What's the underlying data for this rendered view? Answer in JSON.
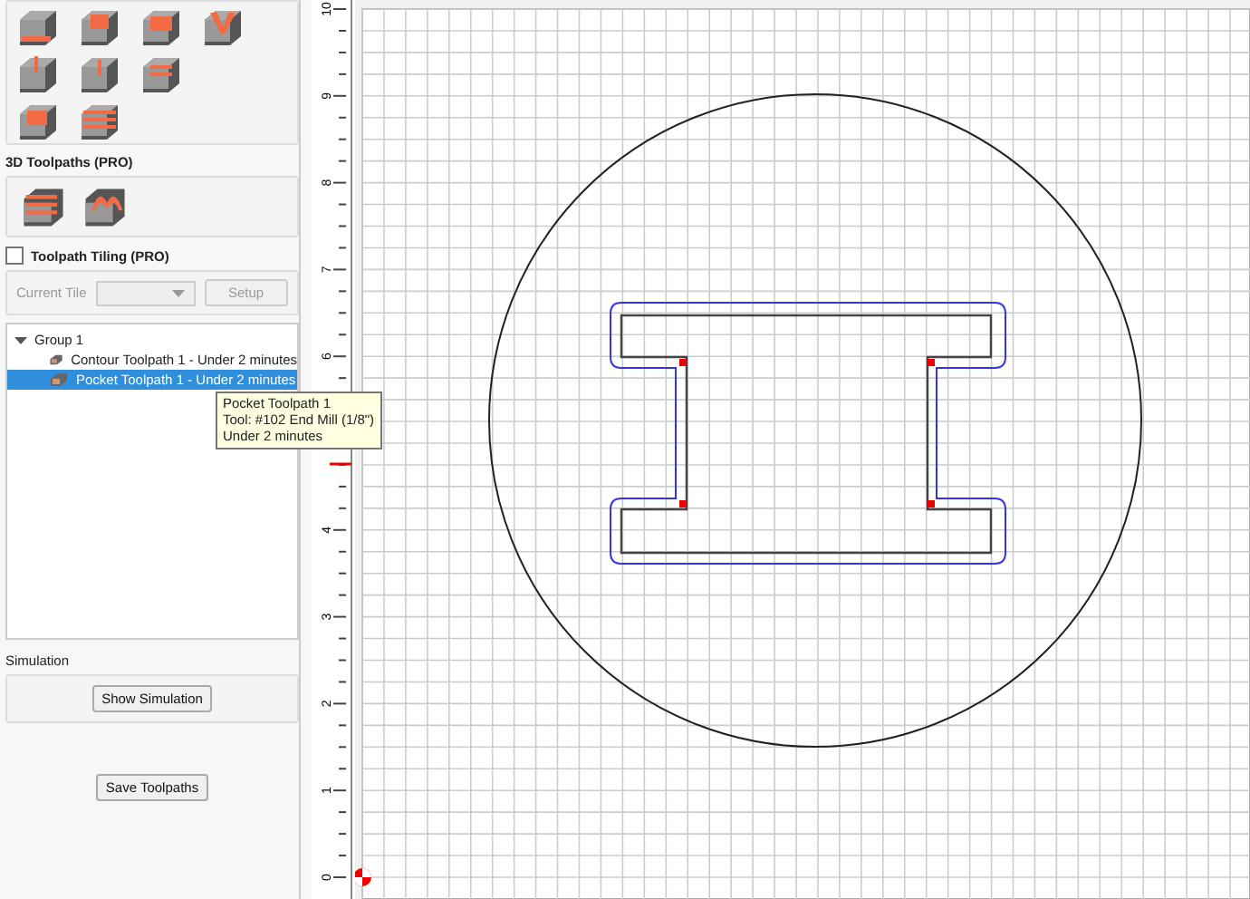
{
  "panel": {
    "toolpaths_3d_label": "3D Toolpaths (PRO)",
    "tiling": {
      "label": "Toolpath Tiling (PRO)",
      "checked": false,
      "disabled": true,
      "current_tile_label": "Current Tile",
      "setup_button": "Setup"
    },
    "tree": [
      {
        "label": "Group 1",
        "expanded": true,
        "selected": false,
        "children": [
          {
            "label": "Contour Toolpath 1 - Under 2 minutes",
            "selected": false
          },
          {
            "label": "Pocket Toolpath 1 - Under 2 minutes",
            "selected": true
          }
        ]
      }
    ],
    "simulation_label": "Simulation",
    "show_simulation_button": "Show Simulation",
    "save_button": "Save Toolpaths"
  },
  "tooltip": {
    "lines": [
      "Pocket Toolpath 1",
      "Tool: #102 End Mill (1/8\")",
      "Under 2 minutes"
    ]
  },
  "ruler": {
    "labels": [
      "0",
      "1",
      "2",
      "3",
      "4",
      "6",
      "7",
      "8",
      "9",
      "10"
    ]
  }
}
